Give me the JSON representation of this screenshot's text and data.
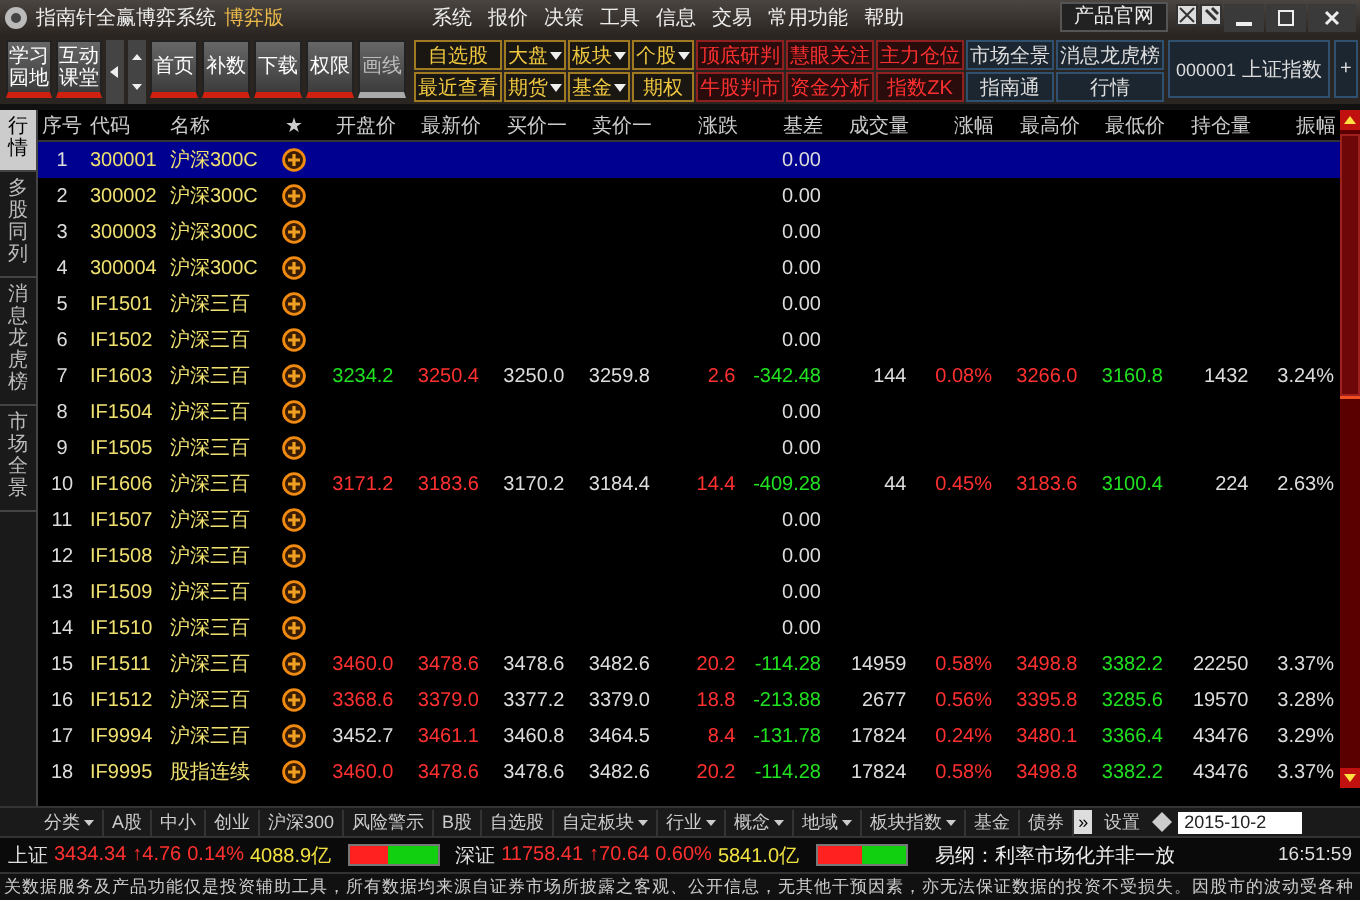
{
  "window": {
    "title": "指南针全赢博弈系统",
    "edition": "博弈版",
    "menu": [
      "系统",
      "报价",
      "决策",
      "工具",
      "信息",
      "交易",
      "常用功能",
      "帮助"
    ],
    "site_button": "产品官网"
  },
  "toolbar": {
    "buttons": [
      {
        "label": "学习园地",
        "kind": "big"
      },
      {
        "label": "互动课堂",
        "kind": "big"
      },
      {
        "kind": "left"
      },
      {
        "kind": "updown"
      },
      {
        "label": "首页",
        "kind": "big"
      },
      {
        "label": "补数",
        "kind": "big"
      },
      {
        "label": "下载",
        "kind": "big"
      },
      {
        "label": "权限",
        "kind": "big"
      },
      {
        "label": "画线",
        "kind": "dim"
      }
    ],
    "grid": [
      [
        {
          "label": "自选股",
          "kind": "gold",
          "dropdown": false
        },
        {
          "label": "最近查看",
          "kind": "gold",
          "dropdown": false
        }
      ],
      [
        {
          "label": "大盘",
          "kind": "gold",
          "dropdown": true
        },
        {
          "label": "期货",
          "kind": "gold",
          "dropdown": true
        }
      ],
      [
        {
          "label": "板块",
          "kind": "gold",
          "dropdown": true
        },
        {
          "label": "基金",
          "kind": "gold",
          "dropdown": true
        }
      ],
      [
        {
          "label": "个股",
          "kind": "gold",
          "dropdown": true
        },
        {
          "label": "期权",
          "kind": "gold",
          "dropdown": false
        }
      ],
      [
        {
          "label": "顶底研判",
          "kind": "red",
          "dropdown": false
        },
        {
          "label": "牛股判市",
          "kind": "red",
          "dropdown": false
        }
      ],
      [
        {
          "label": "慧眼关注",
          "kind": "red",
          "dropdown": false
        },
        {
          "label": "资金分析",
          "kind": "red",
          "dropdown": false
        }
      ],
      [
        {
          "label": "主力仓位",
          "kind": "red",
          "dropdown": false
        },
        {
          "label": "指数ZK",
          "kind": "red",
          "dropdown": false
        }
      ],
      [
        {
          "label": "市场全景",
          "kind": "blue",
          "dropdown": false
        },
        {
          "label": "指南通",
          "kind": "blue",
          "dropdown": false
        }
      ],
      [
        {
          "label": "消息龙虎榜",
          "kind": "blue",
          "dropdown": false
        },
        {
          "label": "行情",
          "kind": "blue",
          "dropdown": false
        }
      ]
    ],
    "index_box": {
      "code": "000001",
      "name": "上证指数"
    },
    "add_button": "+"
  },
  "side_tabs": [
    {
      "label": "行情",
      "selected": true
    },
    {
      "label": "多股同列",
      "selected": false
    },
    {
      "label": "消息龙虎榜",
      "selected": false
    },
    {
      "label": "市场全景",
      "selected": false
    }
  ],
  "table": {
    "columns": [
      "序号",
      "代码",
      "名称",
      "★",
      "开盘价",
      "最新价",
      "买价一",
      "卖价一",
      "涨跌",
      "基差",
      "成交量",
      "涨幅",
      "最高价",
      "最低价",
      "持仓量",
      "振幅"
    ],
    "rows": [
      {
        "selected": true,
        "cells": [
          "1",
          "300001",
          "沪深300C",
          null,
          null,
          null,
          null,
          null,
          null,
          "0.00",
          null,
          null,
          null,
          null,
          null,
          null
        ]
      },
      {
        "selected": false,
        "cells": [
          "2",
          "300002",
          "沪深300C",
          null,
          null,
          null,
          null,
          null,
          null,
          "0.00",
          null,
          null,
          null,
          null,
          null,
          null
        ]
      },
      {
        "selected": false,
        "cells": [
          "3",
          "300003",
          "沪深300C",
          null,
          null,
          null,
          null,
          null,
          null,
          "0.00",
          null,
          null,
          null,
          null,
          null,
          null
        ]
      },
      {
        "selected": false,
        "cells": [
          "4",
          "300004",
          "沪深300C",
          null,
          null,
          null,
          null,
          null,
          null,
          "0.00",
          null,
          null,
          null,
          null,
          null,
          null
        ]
      },
      {
        "selected": false,
        "cells": [
          "5",
          "IF1501",
          "沪深三百",
          null,
          null,
          null,
          null,
          null,
          null,
          "0.00",
          null,
          null,
          null,
          null,
          null,
          null
        ]
      },
      {
        "selected": false,
        "cells": [
          "6",
          "IF1502",
          "沪深三百",
          null,
          null,
          null,
          null,
          null,
          null,
          "0.00",
          null,
          null,
          null,
          null,
          null,
          null
        ]
      },
      {
        "selected": false,
        "cells": [
          "7",
          "IF1603",
          "沪深三百",
          null,
          {
            "v": "3234.2",
            "kind": "down"
          },
          {
            "v": "3250.4",
            "kind": "up"
          },
          "3250.0",
          "3259.8",
          {
            "v": "2.6",
            "kind": "up"
          },
          {
            "v": "-342.48",
            "kind": "down"
          },
          "144",
          {
            "v": "0.08%",
            "kind": "up"
          },
          {
            "v": "3266.0",
            "kind": "up"
          },
          {
            "v": "3160.8",
            "kind": "down"
          },
          "1432",
          "3.24%"
        ]
      },
      {
        "selected": false,
        "cells": [
          "8",
          "IF1504",
          "沪深三百",
          null,
          null,
          null,
          null,
          null,
          null,
          "0.00",
          null,
          null,
          null,
          null,
          null,
          null
        ]
      },
      {
        "selected": false,
        "cells": [
          "9",
          "IF1505",
          "沪深三百",
          null,
          null,
          null,
          null,
          null,
          null,
          "0.00",
          null,
          null,
          null,
          null,
          null,
          null
        ]
      },
      {
        "selected": false,
        "cells": [
          "10",
          "IF1606",
          "沪深三百",
          null,
          {
            "v": "3171.2",
            "kind": "up"
          },
          {
            "v": "3183.6",
            "kind": "up"
          },
          "3170.2",
          "3184.4",
          {
            "v": "14.4",
            "kind": "up"
          },
          {
            "v": "-409.28",
            "kind": "down"
          },
          "44",
          {
            "v": "0.45%",
            "kind": "up"
          },
          {
            "v": "3183.6",
            "kind": "up"
          },
          {
            "v": "3100.4",
            "kind": "down"
          },
          "224",
          "2.63%"
        ]
      },
      {
        "selected": false,
        "cells": [
          "11",
          "IF1507",
          "沪深三百",
          null,
          null,
          null,
          null,
          null,
          null,
          "0.00",
          null,
          null,
          null,
          null,
          null,
          null
        ]
      },
      {
        "selected": false,
        "cells": [
          "12",
          "IF1508",
          "沪深三百",
          null,
          null,
          null,
          null,
          null,
          null,
          "0.00",
          null,
          null,
          null,
          null,
          null,
          null
        ]
      },
      {
        "selected": false,
        "cells": [
          "13",
          "IF1509",
          "沪深三百",
          null,
          null,
          null,
          null,
          null,
          null,
          "0.00",
          null,
          null,
          null,
          null,
          null,
          null
        ]
      },
      {
        "selected": false,
        "cells": [
          "14",
          "IF1510",
          "沪深三百",
          null,
          null,
          null,
          null,
          null,
          null,
          "0.00",
          null,
          null,
          null,
          null,
          null,
          null
        ]
      },
      {
        "selected": false,
        "cells": [
          "15",
          "IF1511",
          "沪深三百",
          null,
          {
            "v": "3460.0",
            "kind": "up"
          },
          {
            "v": "3478.6",
            "kind": "up"
          },
          "3478.6",
          "3482.6",
          {
            "v": "20.2",
            "kind": "up"
          },
          {
            "v": "-114.28",
            "kind": "down"
          },
          "14959",
          {
            "v": "0.58%",
            "kind": "up"
          },
          {
            "v": "3498.8",
            "kind": "up"
          },
          {
            "v": "3382.2",
            "kind": "down"
          },
          "22250",
          "3.37%"
        ]
      },
      {
        "selected": false,
        "cells": [
          "16",
          "IF1512",
          "沪深三百",
          null,
          {
            "v": "3368.6",
            "kind": "up"
          },
          {
            "v": "3379.0",
            "kind": "up"
          },
          "3377.2",
          "3379.0",
          {
            "v": "18.8",
            "kind": "up"
          },
          {
            "v": "-213.88",
            "kind": "down"
          },
          "2677",
          {
            "v": "0.56%",
            "kind": "up"
          },
          {
            "v": "3395.8",
            "kind": "up"
          },
          {
            "v": "3285.6",
            "kind": "down"
          },
          "19570",
          "3.28%"
        ]
      },
      {
        "selected": false,
        "cells": [
          "17",
          "IF9994",
          "沪深三百",
          null,
          "3452.7",
          {
            "v": "3461.1",
            "kind": "up"
          },
          "3460.8",
          "3464.5",
          {
            "v": "8.4",
            "kind": "up"
          },
          {
            "v": "-131.78",
            "kind": "down"
          },
          "17824",
          {
            "v": "0.24%",
            "kind": "up"
          },
          {
            "v": "3480.1",
            "kind": "up"
          },
          {
            "v": "3366.4",
            "kind": "down"
          },
          "43476",
          "3.29%"
        ]
      },
      {
        "selected": false,
        "cells": [
          "18",
          "IF9995",
          "股指连续",
          null,
          {
            "v": "3460.0",
            "kind": "up"
          },
          {
            "v": "3478.6",
            "kind": "up"
          },
          "3478.6",
          "3482.6",
          {
            "v": "20.2",
            "kind": "up"
          },
          {
            "v": "-114.28",
            "kind": "down"
          },
          "17824",
          {
            "v": "0.58%",
            "kind": "up"
          },
          {
            "v": "3498.8",
            "kind": "up"
          },
          {
            "v": "3382.2",
            "kind": "down"
          },
          "43476",
          "3.37%"
        ]
      }
    ]
  },
  "category_tabs": [
    {
      "label": "分类",
      "dropdown": true
    },
    {
      "label": "A股",
      "dropdown": false
    },
    {
      "label": "中小",
      "dropdown": false
    },
    {
      "label": "创业",
      "dropdown": false
    },
    {
      "label": "沪深300",
      "dropdown": false
    },
    {
      "label": "风险警示",
      "dropdown": false
    },
    {
      "label": "B股",
      "dropdown": false
    },
    {
      "label": "自选股",
      "dropdown": false
    },
    {
      "label": "自定板块",
      "dropdown": true
    },
    {
      "label": "行业",
      "dropdown": true
    },
    {
      "label": "概念",
      "dropdown": true
    },
    {
      "label": "地域",
      "dropdown": true
    },
    {
      "label": "板块指数",
      "dropdown": true
    },
    {
      "label": "基金",
      "dropdown": false
    },
    {
      "label": "债券",
      "dropdown": false
    }
  ],
  "more_button": "»",
  "settings_button": "设置",
  "date": "2015-10-2",
  "indices": [
    {
      "name": "上证",
      "value": "3434.34",
      "change": "↑4.76",
      "percent": "0.14%",
      "amount": "4088.9亿",
      "level": 0.45
    },
    {
      "name": "深证",
      "value": "11758.41",
      "change": "↑70.64",
      "percent": "0.60%",
      "amount": "5841.0亿",
      "level": 0.5
    }
  ],
  "news": "易纲：利率市场化并非一放",
  "clock": "16:51:59",
  "disclaimer": "关数据服务及产品功能仅是投资辅助工具，所有数据均来源自证券市场所披露之客观、公开信息，无其他干预因素，亦无法保证数据的投资不受损失。因股市的波动受各种"
}
